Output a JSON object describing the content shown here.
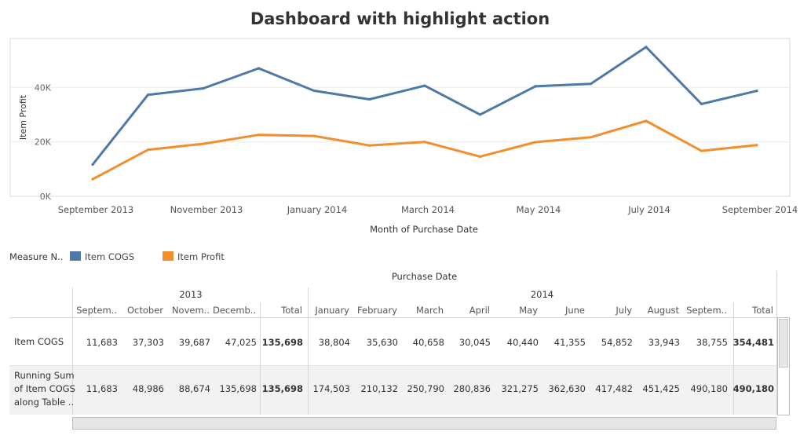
{
  "title": "Dashboard with highlight action",
  "chart_data": {
    "type": "line",
    "x": [
      "2013-09",
      "2013-10",
      "2013-11",
      "2013-12",
      "2014-01",
      "2014-02",
      "2014-03",
      "2014-04",
      "2014-05",
      "2014-06",
      "2014-07",
      "2014-08",
      "2014-09"
    ],
    "x_tick_labels": [
      "September 2013",
      "November 2013",
      "January 2014",
      "March 2014",
      "May 2014",
      "July 2014",
      "September 2014"
    ],
    "xlabel": "Month of Purchase Date",
    "ylabel": "Item Profit",
    "y_tick_labels": [
      "0K",
      "20K",
      "40K"
    ],
    "y_ticks": [
      0,
      20000,
      40000
    ],
    "ylim": [
      0,
      58000
    ],
    "grid": true,
    "series": [
      {
        "name": "Item COGS",
        "color": "#4e79a7",
        "values": [
          11683,
          37303,
          39687,
          47025,
          38804,
          35630,
          40658,
          30045,
          40440,
          41355,
          54852,
          33943,
          38755
        ]
      },
      {
        "name": "Item Profit",
        "color": "#f28e2b",
        "values": [
          6300,
          17100,
          19300,
          22600,
          22200,
          18700,
          20000,
          14600,
          19900,
          21700,
          27700,
          16700,
          18800
        ]
      }
    ],
    "legend": {
      "title": "Measure N..",
      "placement": "below-left"
    }
  },
  "table": {
    "header": "Purchase Date",
    "years": [
      "2013",
      "2014"
    ],
    "columns_2013": [
      "Septem..",
      "October",
      "Novem..",
      "Decemb..",
      "Total"
    ],
    "columns_2014": [
      "January",
      "February",
      "March",
      "April",
      "May",
      "June",
      "July",
      "August",
      "Septem..",
      "Total"
    ],
    "rows": [
      {
        "label": "Item COGS",
        "values_2013": [
          "11,683",
          "37,303",
          "39,687",
          "47,025",
          "135,698"
        ],
        "values_2014": [
          "38,804",
          "35,630",
          "40,658",
          "30,045",
          "40,440",
          "41,355",
          "54,852",
          "33,943",
          "38,755",
          "354,481"
        ]
      },
      {
        "label_lines": [
          "Running Sum",
          "of Item COGS",
          "along Table .."
        ],
        "values_2013": [
          "11,683",
          "48,986",
          "88,674",
          "135,698",
          "135,698"
        ],
        "values_2014": [
          "174,503",
          "210,132",
          "250,790",
          "280,836",
          "321,275",
          "362,630",
          "417,482",
          "451,425",
          "490,180",
          "490,180"
        ]
      }
    ]
  }
}
